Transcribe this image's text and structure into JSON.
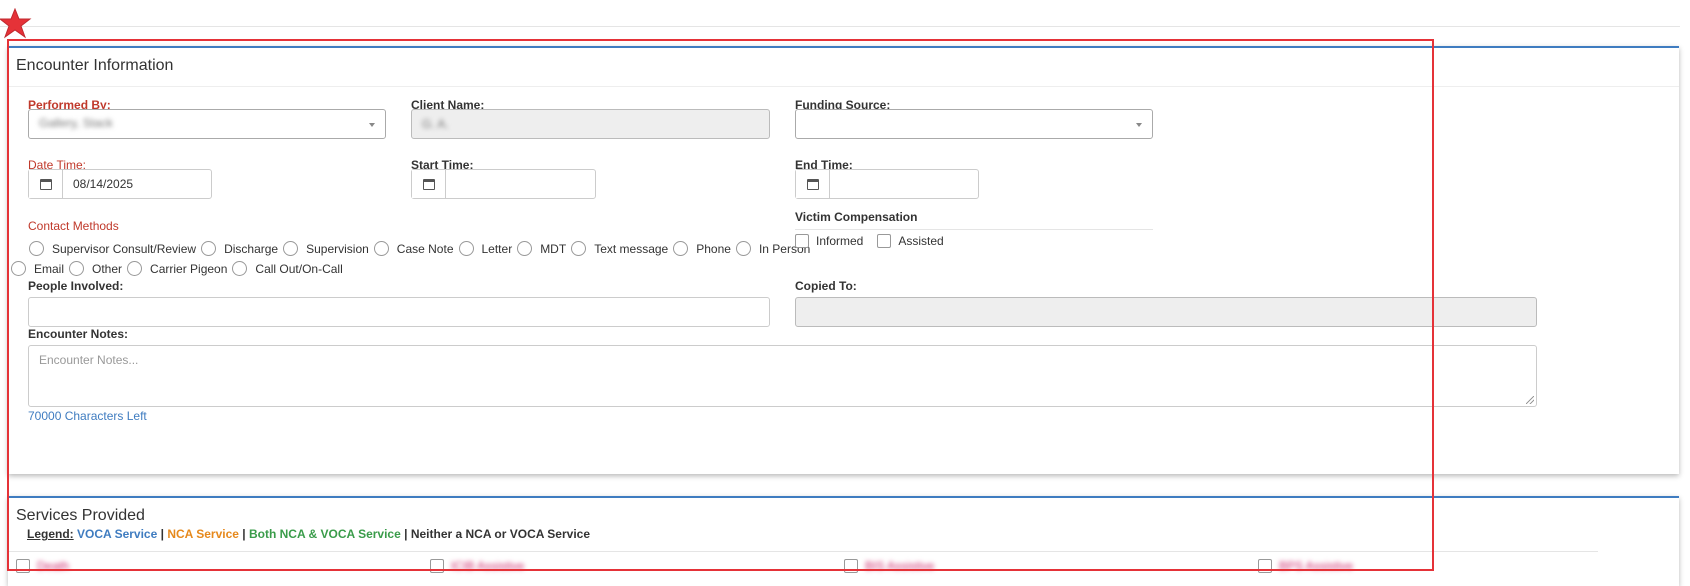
{
  "encounter": {
    "title": "Encounter Information",
    "performed_by": {
      "label": "Performed By:",
      "value": "Gallery, Stack"
    },
    "client_name": {
      "label": "Client Name:",
      "value": "G. A."
    },
    "funding_source": {
      "label": "Funding Source:",
      "value": ""
    },
    "date_time": {
      "label": "Date Time:",
      "value": "08/14/2025"
    },
    "start_time": {
      "label": "Start Time:",
      "value": ""
    },
    "end_time": {
      "label": "End Time:",
      "value": ""
    },
    "contact_methods": {
      "label": "Contact Methods",
      "options": [
        "Supervisor Consult/Review",
        "Discharge",
        "Supervision",
        "Case Note",
        "Letter",
        "MDT",
        "Text message",
        "Phone",
        "In Person",
        "Email",
        "Other",
        "Carrier Pigeon",
        "Call Out/On-Call"
      ]
    },
    "victim_compensation": {
      "label": "Victim Compensation",
      "options": [
        "Informed",
        "Assisted"
      ]
    },
    "people_involved": {
      "label": "People Involved:",
      "value": ""
    },
    "copied_to": {
      "label": "Copied To:",
      "value": ""
    },
    "notes": {
      "label": "Encounter Notes:",
      "placeholder": "Encounter Notes...",
      "chars_left": "70000 Characters Left"
    }
  },
  "services": {
    "title": "Services Provided",
    "legend_label": "Legend:",
    "legend": {
      "voca": "VOCA Service",
      "nca": "NCA Service",
      "both": "Both NCA & VOCA Service",
      "neither": "Neither a NCA or VOCA Service",
      "separator": "|"
    },
    "items": [
      "Death",
      "ICIB Assistive",
      "BIS Assistive",
      "BPS Assistive"
    ]
  },
  "colors": {
    "accent": "#3f7cc0",
    "required": "#c0392b",
    "highlight": "#e53238",
    "nca": "#e6891c",
    "both": "#3a9c4a"
  }
}
